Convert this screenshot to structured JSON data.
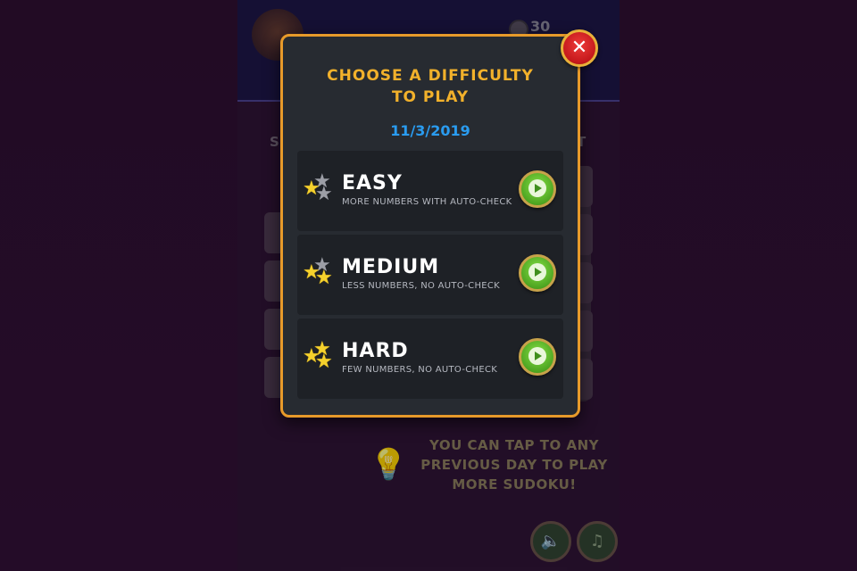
{
  "background": {
    "coin_count": "30",
    "hint_text_lines": [
      "YOU CAN TAP TO ANY",
      "PREVIOUS DAY TO PLAY",
      "MORE SUDOKU!"
    ],
    "hint_icon": "lightbulb-icon",
    "sound_icon": "speaker-icon",
    "music_icon": "music-note-icon"
  },
  "dialog": {
    "title_line1": "CHOOSE A DIFFICULTY",
    "title_line2": "TO PLAY",
    "date": "11/3/2019",
    "close_icon": "close-icon",
    "levels": [
      {
        "name": "EASY",
        "description": "MORE NUMBERS WITH AUTO-CHECK",
        "gold_stars": 1,
        "total_stars": 3
      },
      {
        "name": "MEDIUM",
        "description": "LESS NUMBERS, NO AUTO-CHECK",
        "gold_stars": 2,
        "total_stars": 3
      },
      {
        "name": "HARD",
        "description": "FEW NUMBERS, NO AUTO-CHECK",
        "gold_stars": 3,
        "total_stars": 3
      }
    ]
  },
  "colors": {
    "dialog_border": "#e79a2a",
    "title": "#f2b12b",
    "date": "#2a9cf0",
    "play_button": "#4aa11f",
    "close_button": "#c4181c"
  }
}
